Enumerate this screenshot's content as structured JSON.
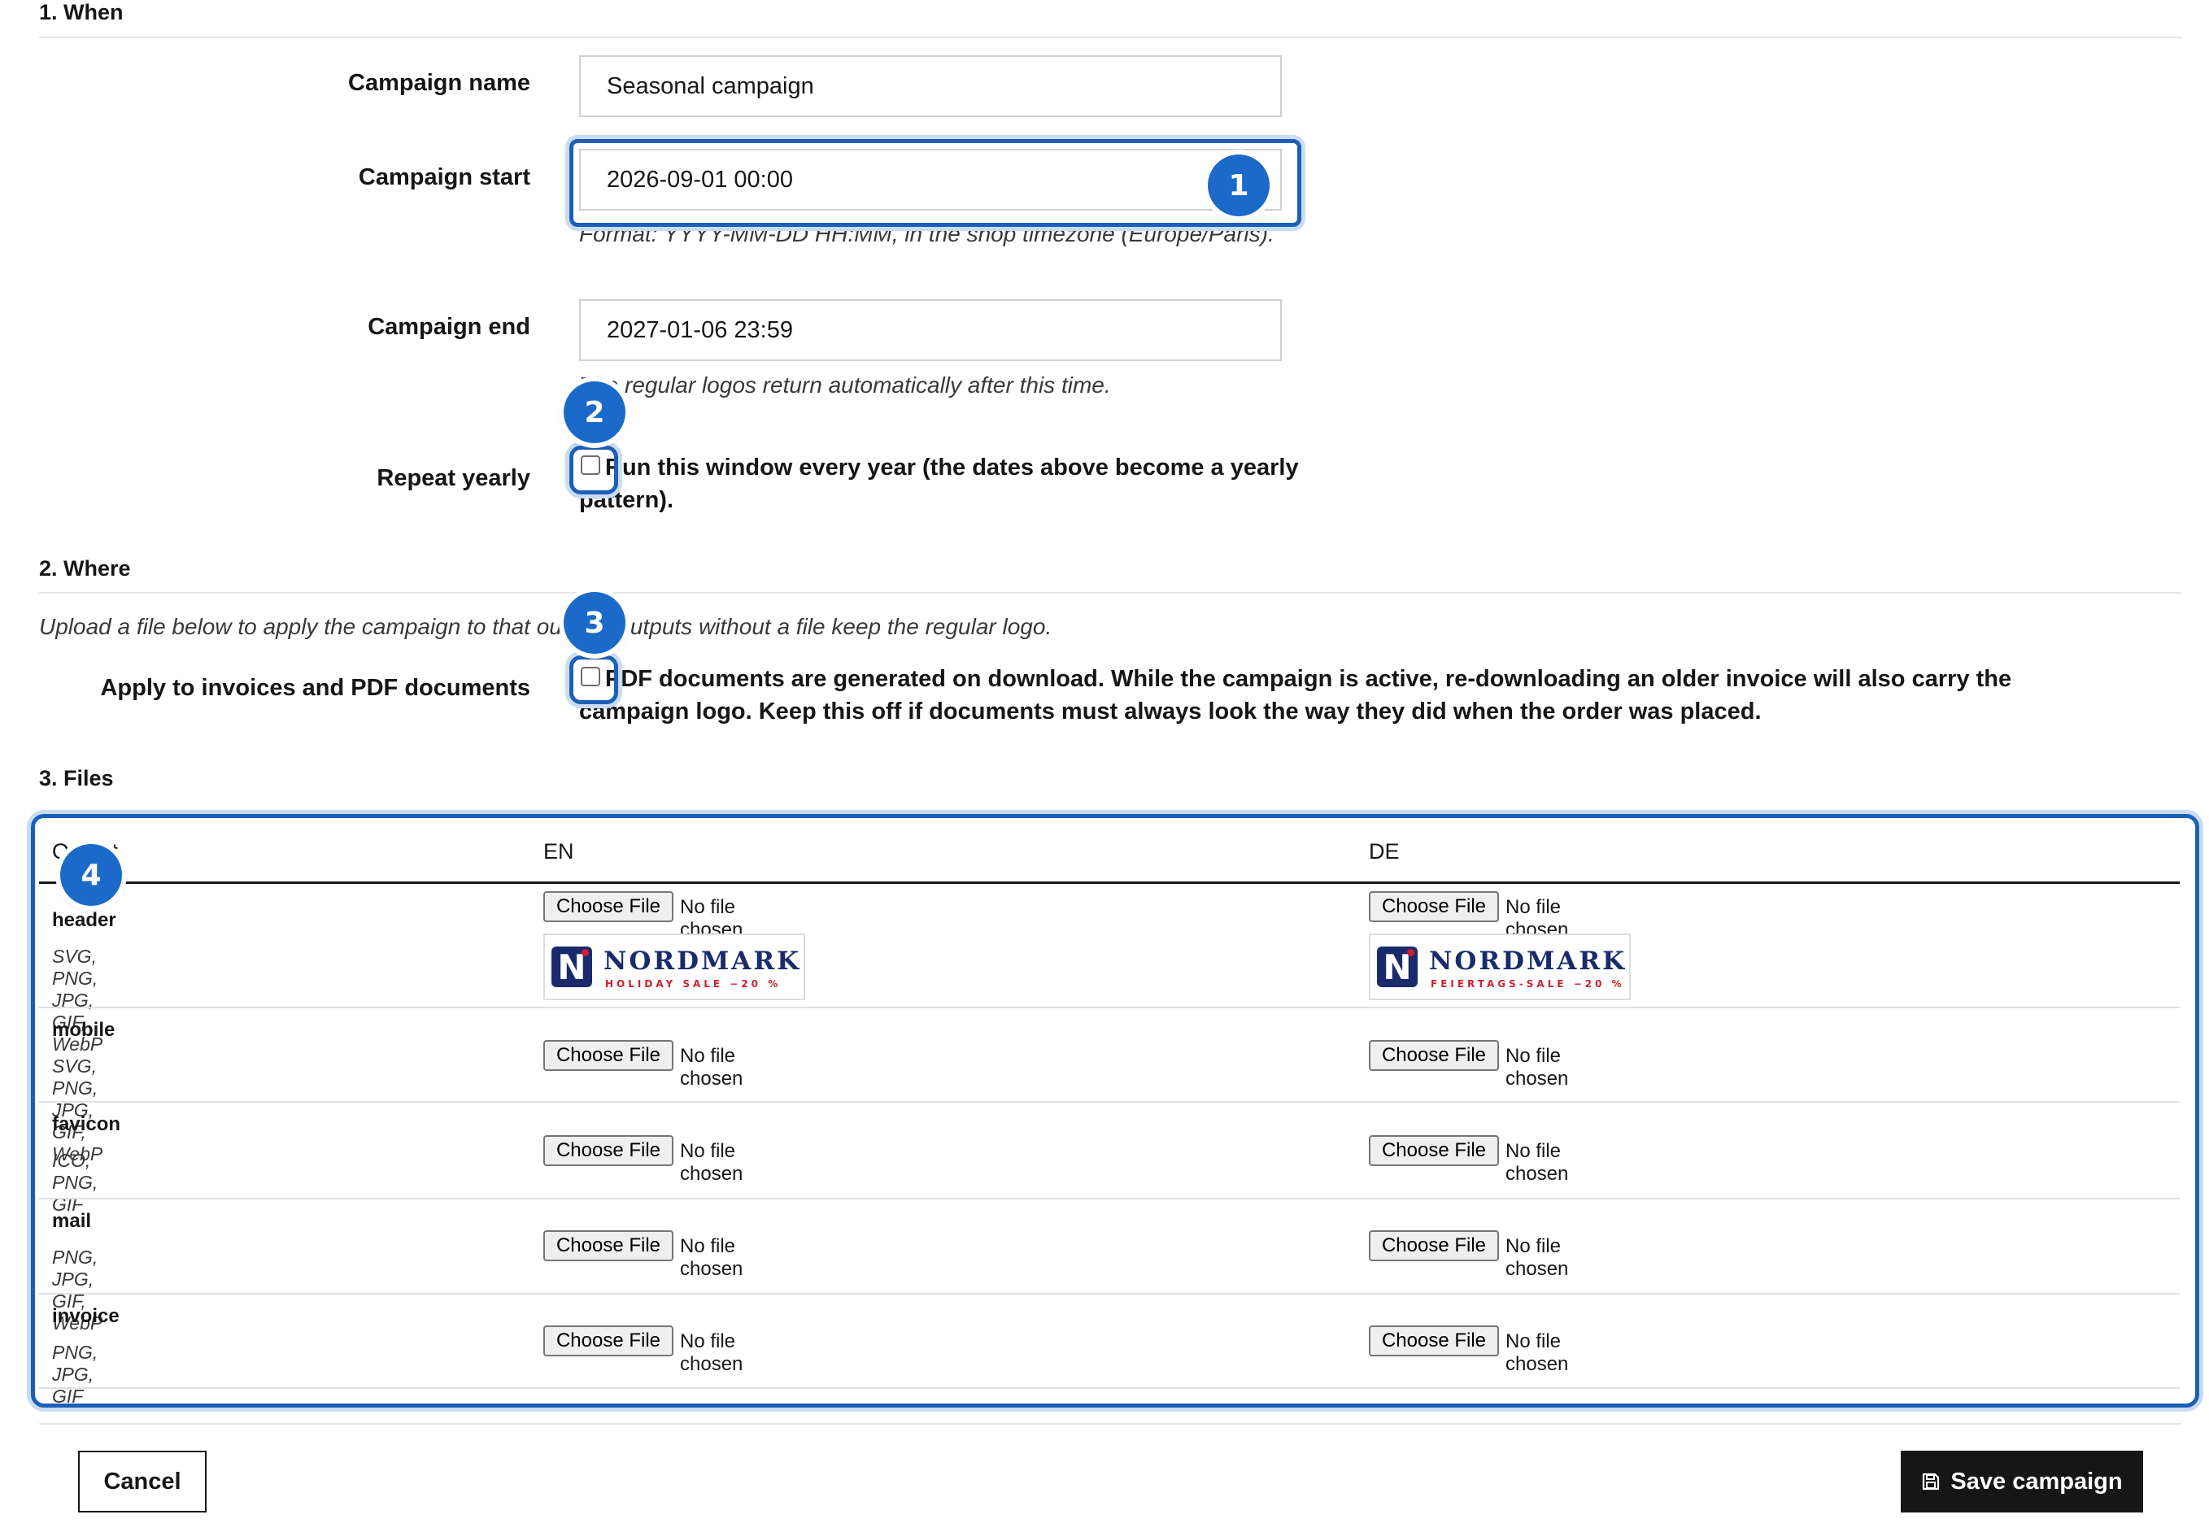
{
  "sections": {
    "when": "1. When",
    "where": "2. Where",
    "files": "3. Files"
  },
  "campaign_name": {
    "label": "Campaign name",
    "value": "Seasonal campaign"
  },
  "campaign_start": {
    "label": "Campaign start",
    "value": "2026-09-01 00:00",
    "hint": "Format: YYYY-MM-DD HH:MM, in the shop timezone (Europe/Paris)."
  },
  "campaign_end": {
    "label": "Campaign end",
    "value": "2027-01-06 23:59",
    "hint": "The regular logos return automatically after this time."
  },
  "repeat_yearly": {
    "label": "Repeat yearly",
    "text_line1": "Run this window every year (the dates above become a yearly",
    "text_line2": "pattern).",
    "checked": false
  },
  "where": {
    "intro": "Upload a file below to apply the campaign to that output. Outputs without a file keep the regular logo.",
    "apply_invoices_label": "Apply to invoices and PDF documents",
    "apply_text_line1": "PDF documents are generated on download. While the campaign is active, re-downloading an older invoice will also carry the",
    "apply_text_line2": "campaign logo. Keep this off if documents must always look the way they did when the order was placed.",
    "checked": false
  },
  "files_table": {
    "headers": [
      "Output",
      "EN",
      "DE"
    ],
    "choose_label": "Choose File",
    "no_file_label": "No file chosen",
    "rows": [
      {
        "name": "header",
        "formats": "SVG, PNG, JPG, GIF, WebP"
      },
      {
        "name": "mobile",
        "formats": "SVG, PNG, JPG, GIF, WebP"
      },
      {
        "name": "favicon",
        "formats": "ICO, PNG, GIF"
      },
      {
        "name": "mail",
        "formats": "PNG, JPG, GIF, WebP"
      },
      {
        "name": "invoice",
        "formats": "PNG, JPG, GIF"
      }
    ],
    "logos": {
      "en": {
        "mark": "N",
        "word": "NORDMARK",
        "sub": "HOLIDAY SALE −20 %"
      },
      "de": {
        "mark": "N",
        "word": "NORDMARK",
        "sub": "FEIERTAGS-SALE −20 %"
      }
    }
  },
  "badges": [
    "1",
    "2",
    "3",
    "4"
  ],
  "actions": {
    "cancel": "Cancel",
    "save": "Save campaign",
    "save_icon": "floppy-disk-icon"
  },
  "colors": {
    "accent": "#1b6ac9",
    "highlight_border": "#1c5fb8",
    "primary_button": "#161616"
  }
}
